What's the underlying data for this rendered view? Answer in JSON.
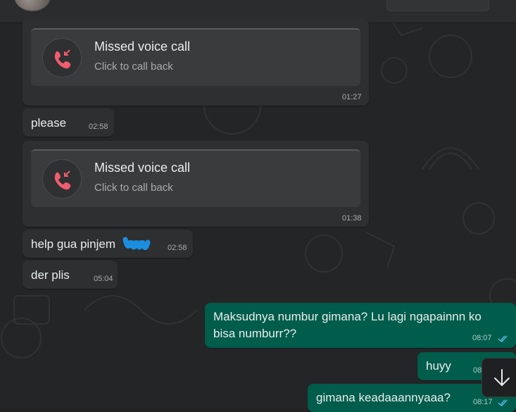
{
  "colors": {
    "incoming_bubble": "#2e2f30",
    "outgoing_bubble": "#005c4b",
    "missed_call_red": "#f15c6d",
    "read_ticks": "#53bdeb"
  },
  "messages": [
    {
      "type": "missed_call",
      "title": "Missed voice call",
      "subtitle": "Click to call back",
      "time": "01:27"
    },
    {
      "type": "incoming",
      "text": "please",
      "time": "02:58"
    },
    {
      "type": "missed_call",
      "title": "Missed voice call",
      "subtitle": "Click to call back",
      "time": "01:38"
    },
    {
      "type": "incoming",
      "text": "help gua pinjem",
      "time": "02:58"
    },
    {
      "type": "incoming",
      "text": "der plis",
      "time": "05:04"
    },
    {
      "type": "outgoing",
      "text_line1": "Maksudnya numbur gimana? Lu lagi ngapainnn ko",
      "text_line2": "bisa numburr??",
      "time": "08:07"
    },
    {
      "type": "outgoing",
      "text": "huyy",
      "time": "08"
    },
    {
      "type": "outgoing",
      "text": "gimana keadaaannyaaa?",
      "time": "08:17"
    }
  ],
  "icons": {
    "missed_call": "missed-call-icon",
    "read_receipt": "double-check-icon",
    "scroll_down": "arrow-down-icon"
  }
}
